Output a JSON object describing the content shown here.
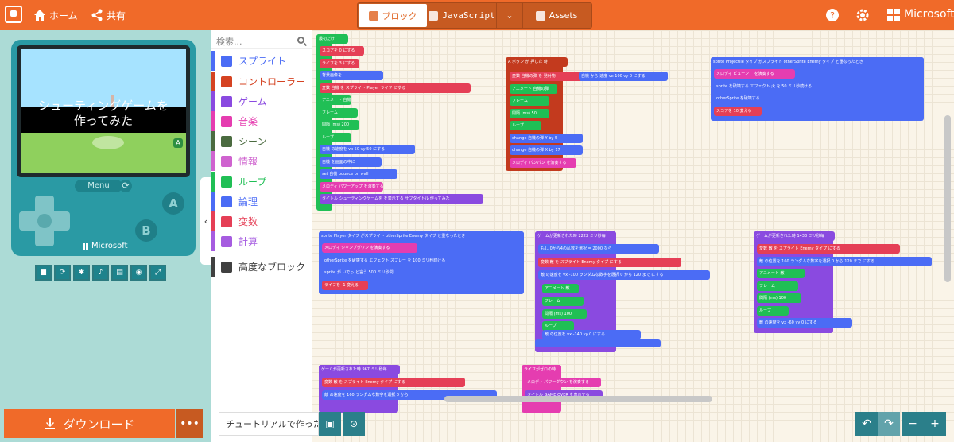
{
  "header": {
    "home_label": "ホーム",
    "share_label": "共有",
    "tabs": [
      {
        "label": "ブロック",
        "icon": "puzzle-icon",
        "active": true
      },
      {
        "label": "JavaScript",
        "icon": "javascript-icon",
        "active": false
      },
      {
        "label": "Assets",
        "icon": "image-icon",
        "active": false
      }
    ],
    "brand": "Microsoft",
    "accent": "#f06a29"
  },
  "simulator": {
    "game_text_line1": "シューティングゲームを",
    "game_text_line2": "作ってみた",
    "menu_label": "Menu",
    "a_label": "A",
    "b_label": "B",
    "device_brand": "Microsoft"
  },
  "download": {
    "label": "ダウンロード",
    "more_label": "•••"
  },
  "toolbox": {
    "search_placeholder": "検索...",
    "categories": [
      {
        "label": "スプライト",
        "color": "#4b6cf5",
        "icon": "paper-plane-icon"
      },
      {
        "label": "コントローラー",
        "color": "#d54322",
        "icon": "gamepad-icon"
      },
      {
        "label": "ゲーム",
        "color": "#8a4ae0",
        "icon": "circle-icon"
      },
      {
        "label": "音楽",
        "color": "#e53db0",
        "icon": "headphones-icon"
      },
      {
        "label": "シーン",
        "color": "#4b6b40",
        "icon": "tree-icon"
      },
      {
        "label": "情報",
        "color": "#cf63cf",
        "icon": "id-card-icon"
      },
      {
        "label": "ループ",
        "color": "#20bf55",
        "icon": "refresh-icon"
      },
      {
        "label": "論理",
        "color": "#4b6cf5",
        "icon": "shuffle-icon"
      },
      {
        "label": "変数",
        "color": "#e53f56",
        "icon": "list-icon"
      },
      {
        "label": "計算",
        "color": "#a65ce0",
        "icon": "calculator-icon"
      },
      {
        "label": "高度なブロック",
        "color": "#404040",
        "icon": "chevron-down-icon"
      }
    ]
  },
  "workspace": {
    "blocks": {
      "onstart_title": "最初だけ",
      "stack1": [
        "スコアを 0 にする",
        "ライフを 3 にする",
        "背景画像を",
        "変数 自機 を スプライト Player ライフ にする",
        "アニメート 自機",
        "フレーム",
        "間隔 (ms) 200",
        "ループ",
        "自機 の速度を vx 50 vy 50 にする",
        "自機 を画面の中に",
        "set 自機 bounce on wall",
        "メロディ パワーアップ を演奏する",
        "タイトル シューティングゲームを を表示する サブタイトル 作ってみた"
      ],
      "stack2_title": "A ボタン が 押した 時",
      "stack2": [
        "変数 自機の弾 を 発射物",
        "自機 から 速度 vx 100 vy 0 にする",
        "アニメート 自機の弾",
        "フレーム",
        "間隔 (ms) 50",
        "ループ",
        "change 自機の弾 Y by 5",
        "change 自機の弾 X by 17",
        "メロディ パンパン を演奏する"
      ],
      "stack3_title": "sprite Projectile タイプ がスプライト otherSprite Enemy タイプ と重なったとき",
      "stack3": [
        "メロディ ピューン！ を演奏する",
        "sprite を破壊する エフェクト 火 を 50 ミリ秒続ける",
        "otherSprite を破壊する",
        "スコアを 10 変える"
      ],
      "stack4_title": "sprite Player タイプ がスプライト otherSprite Enemy タイプ と重なったとき",
      "stack4": [
        "メロディ ジャンプダウン を演奏する",
        "otherSprite を破壊する エフェクト スプレー を 100 ミリ秒続ける",
        "sprite が いでっ と言う 500 ミリ秒間",
        "ライフを -1 変える"
      ],
      "stack5_title": "ゲームが更新された時 2222 ミリ秒毎",
      "stack5": [
        "もし 0から4の乱数を選択 = 2000 なら",
        "変数 敵 を スプライト Enemy タイプ にする",
        "敵 の速度を vx -100 ランダムな数字を選択 0 から 120 まで にする",
        "アニメート 敵",
        "フレーム",
        "間隔 (ms) 100",
        "ループ",
        "敵 の位置を vx -140 vy 0 にする"
      ],
      "stack6_title": "ゲームが更新された時 1433 ミリ秒毎",
      "stack6": [
        "変数 敵 を スプライト Enemy タイプ にする",
        "敵 の位置を 160 ランダムな数字を選択 0 から 120 まで にする",
        "アニメート 敵",
        "フレーム",
        "間隔 (ms) 100",
        "ループ",
        "敵 の速度を vx -60 vy 0 にする"
      ],
      "stack7_title": "ゲームが更新された時 967 ミリ秒毎",
      "stack7": [
        "変数 敵 を スプライト Enemy タイプ にする",
        "敵 の速度を 160 ランダムな数字を選択 0 から"
      ],
      "stack8_title": "ライフがゼロの時",
      "stack8": [
        "メロディ パワーダウン を演奏する",
        "タイトル GAME OVER を表示する"
      ]
    }
  },
  "bottom": {
    "project_name": "チュートリアルで作ったシューティングゲーム"
  }
}
